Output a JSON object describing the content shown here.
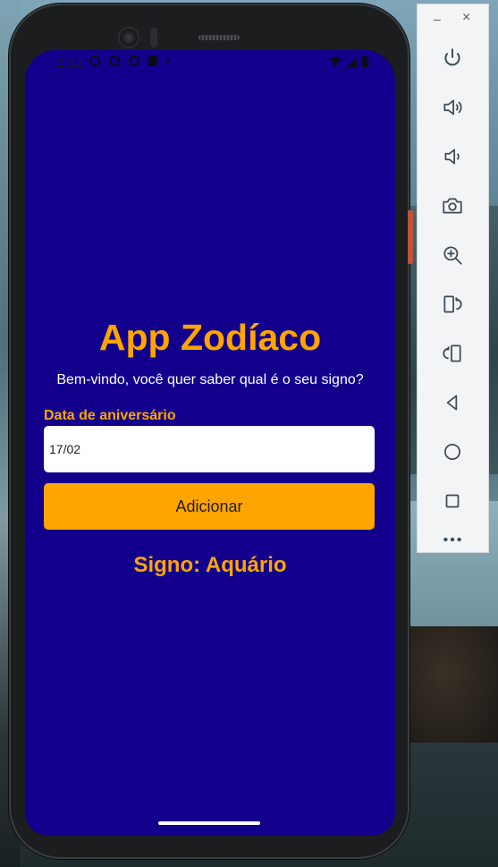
{
  "status_bar": {
    "time": "2:12"
  },
  "app": {
    "title": "App Zodíaco",
    "subtitle": "Bem-vindo, você quer saber qual é o seu signo?",
    "birthday_label": "Data de aniversário",
    "birthday_value": "17/02",
    "add_button_label": "Adicionar",
    "result_text": "Signo: Aquário"
  },
  "colors": {
    "screen_background": "#12008c",
    "accent": "#ffa500",
    "input_background": "#ffffff"
  },
  "emulator_toolbar": {
    "window_controls": {
      "minimize": "–",
      "close": "×"
    },
    "buttons": [
      "power-icon",
      "volume-up-icon",
      "volume-down-icon",
      "camera-icon",
      "zoom-in-icon",
      "rotate-left-icon",
      "rotate-right-icon",
      "back-icon",
      "home-icon",
      "overview-icon",
      "more-icon"
    ]
  }
}
